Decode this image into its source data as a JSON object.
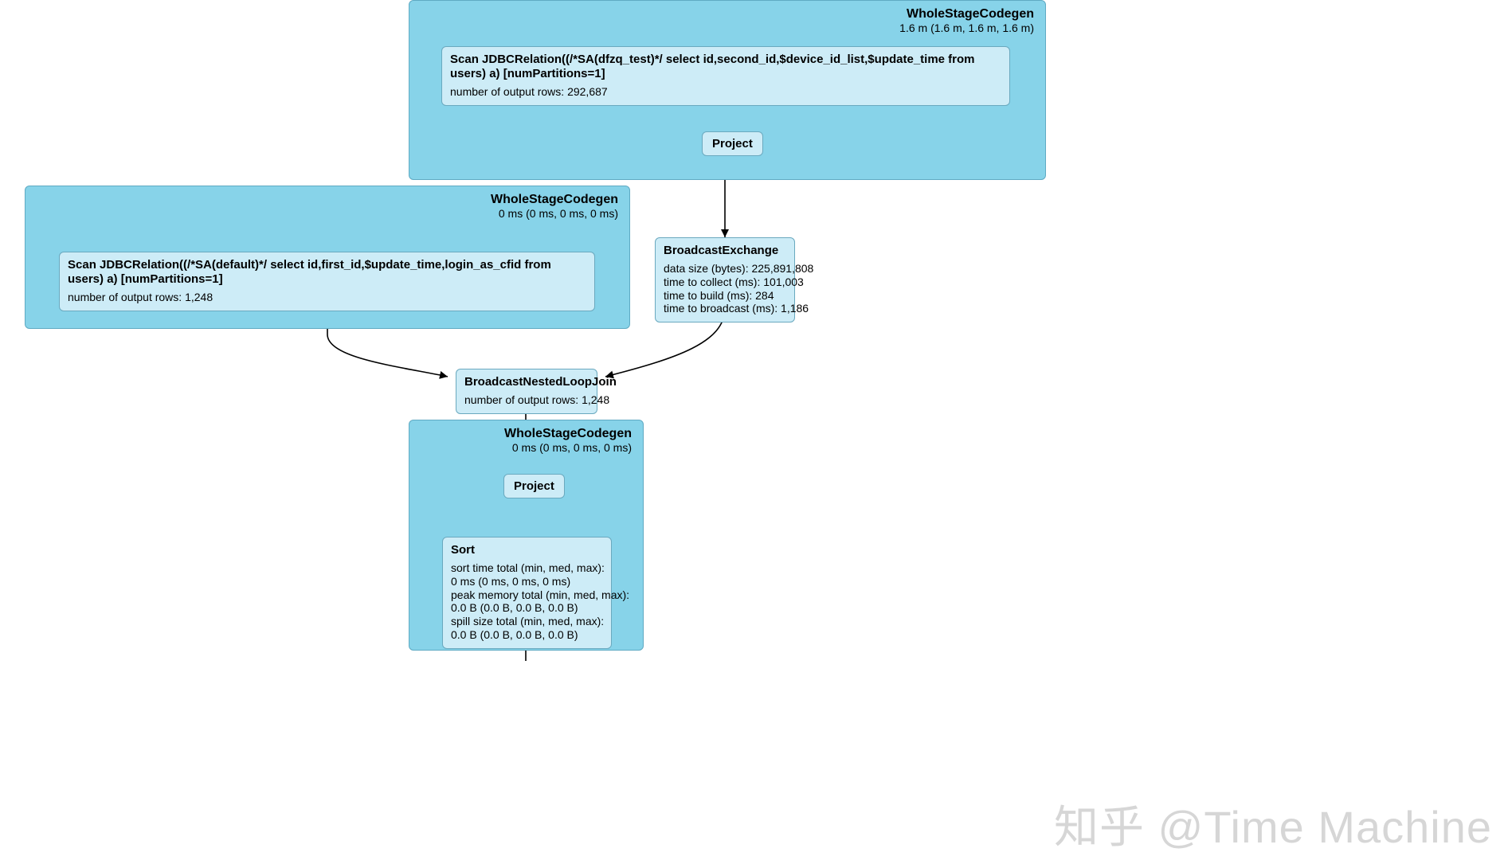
{
  "stages": {
    "top": {
      "title": "WholeStageCodegen",
      "subtitle": "1.6 m (1.6 m, 1.6 m, 1.6 m)"
    },
    "left": {
      "title": "WholeStageCodegen",
      "subtitle": "0 ms (0 ms, 0 ms, 0 ms)"
    },
    "bottom": {
      "title": "WholeStageCodegen",
      "subtitle": "0 ms (0 ms, 0 ms, 0 ms)"
    }
  },
  "nodes": {
    "scan_top": {
      "title": "Scan JDBCRelation((/*SA(dfzq_test)*/ select id,second_id,$device_id_list,$update_time from users) a) [numPartitions=1]",
      "metric": "number of output rows: 292,687"
    },
    "project_top": {
      "label": "Project"
    },
    "broadcast_exchange": {
      "title": "BroadcastExchange",
      "lines": [
        "data size (bytes): 225,891,808",
        "time to collect (ms): 101,003",
        "time to build (ms): 284",
        "time to broadcast (ms): 1,186"
      ]
    },
    "scan_left": {
      "title": "Scan JDBCRelation((/*SA(default)*/ select id,first_id,$update_time,login_as_cfid from users) a) [numPartitions=1]",
      "metric": "number of output rows: 1,248"
    },
    "bnl_join": {
      "title": "BroadcastNestedLoopJoin",
      "metric": "number of output rows: 1,248"
    },
    "project_bottom": {
      "label": "Project"
    },
    "sort": {
      "title": "Sort",
      "lines": [
        "sort time total (min, med, max):",
        "0 ms (0 ms, 0 ms, 0 ms)",
        "peak memory total (min, med, max):",
        "0.0 B (0.0 B, 0.0 B, 0.0 B)",
        "spill size total (min, med, max):",
        "0.0 B (0.0 B, 0.0 B, 0.0 B)"
      ]
    }
  },
  "watermark": "知乎 @Time Machine"
}
